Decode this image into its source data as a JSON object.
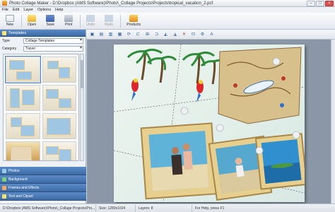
{
  "window": {
    "title": "Photo Collage Maker - D:\\Dropbox (AMS Software)\\Photo\\_Collage Projects\\Projects\\tropical_vacation_2.pcf"
  },
  "menu": [
    "File",
    "Edit",
    "Layer",
    "Options",
    "Help"
  ],
  "toolbar": {
    "new": "New",
    "open": "Open",
    "save": "Save",
    "print": "Print",
    "undo": "Undo",
    "redo": "Redo",
    "products": "Products"
  },
  "left_panel": {
    "header": "Templates",
    "type_label": "Type",
    "type_value": "Collage Templates",
    "category_label": "Category",
    "category_value": "Travel",
    "accordion": [
      "Photos",
      "Background",
      "Frames and Effects",
      "Text and Clipart"
    ]
  },
  "status": {
    "path": "D:\\Dropbox (AMS Software)\\Photo\\_Collage Projects\\Pro...",
    "size": "Size: 1280x1024",
    "layers": "Layers: 8",
    "help": "For Help, press F1"
  },
  "colors": {
    "panel_header": "#3d6aa5",
    "canvas_bg": "#8b97a6"
  }
}
